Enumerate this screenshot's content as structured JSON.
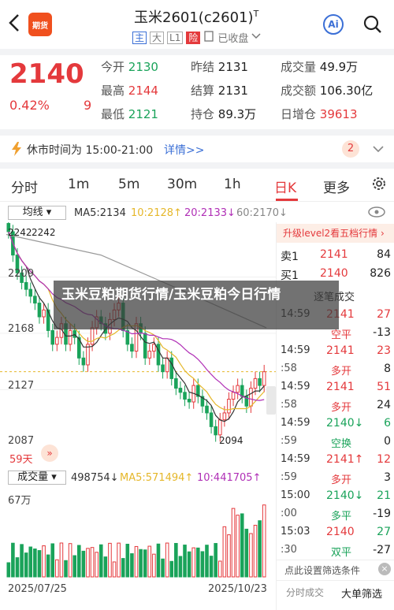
{
  "header": {
    "back_icon": "chevron-left-icon",
    "logo_text": "期货",
    "title": "玉米2601(c2601)",
    "title_sup": "T",
    "tag_main": "主",
    "tag_big": "大",
    "tag_l1": "L1",
    "tag_risk": "险",
    "favorite_label": "已收盘",
    "ai_label": "Ai"
  },
  "quote": {
    "price": "2140",
    "change_pct": "0.42%",
    "change": "9",
    "fields": [
      {
        "k": "今开",
        "v": "2130",
        "c": "green"
      },
      {
        "k": "昨结",
        "v": "2131",
        "c": "plain"
      },
      {
        "k": "成交量",
        "v": "49.9万",
        "c": "plain"
      },
      {
        "k": "最高",
        "v": "2144",
        "c": "red"
      },
      {
        "k": "结算",
        "v": "2131",
        "c": "plain"
      },
      {
        "k": "成交额",
        "v": "106.30亿",
        "c": "plain"
      },
      {
        "k": "最低",
        "v": "2121",
        "c": "green"
      },
      {
        "k": "持仓",
        "v": "89.3万",
        "c": "plain"
      },
      {
        "k": "日增仓",
        "v": "39613",
        "c": "red"
      }
    ]
  },
  "notice": {
    "text": "休市时间为 15:00-21:00",
    "link": "详情>>",
    "badge": "2"
  },
  "tabs": [
    "分时",
    "1m",
    "5m",
    "30m",
    "1h",
    "日K",
    "更多"
  ],
  "active_tab": "日K",
  "chart": {
    "ma_selector": "均线",
    "ma5_label": "MA5:2134",
    "ma10_label": "10:2128↑",
    "ma20_label": "20:2133↓",
    "ma60_label": "60:2170↓",
    "y_ticks": [
      "2242",
      "2209",
      "2168",
      "2127",
      "2087"
    ],
    "high_label": "2242",
    "low_label": "2094",
    "period_label": "59天",
    "vol_selector": "成交量",
    "vol_value": "498754↓",
    "vol_ma5": "MA5:571494↑",
    "vol_ma10": "10:441705↑",
    "vol_axis": "67万",
    "date_start": "2025/07/25",
    "date_end": "2025/10/23",
    "colors": {
      "up": "#e4393c",
      "down": "#1aa35a",
      "ma5": "#333333",
      "ma10": "#e5b72a",
      "ma20": "#b02fb6",
      "ma60": "#999999"
    }
  },
  "chart_data": {
    "type": "candlestick",
    "ylim": [
      2087,
      2242
    ],
    "days": 59,
    "close": [
      2242,
      2225,
      2212,
      2205,
      2200,
      2195,
      2190,
      2180,
      2185,
      2170,
      2160,
      2165,
      2175,
      2160,
      2170,
      2165,
      2150,
      2145,
      2160,
      2172,
      2180,
      2175,
      2168,
      2178,
      2185,
      2190,
      2170,
      2160,
      2155,
      2175,
      2168,
      2150,
      2155,
      2160,
      2145,
      2140,
      2150,
      2135,
      2128,
      2125,
      2120,
      2118,
      2130,
      2122,
      2115,
      2110,
      2100,
      2094,
      2105,
      2110,
      2120,
      2125,
      2130,
      2122,
      2115,
      2128,
      2135,
      2130,
      2140
    ]
  },
  "side_panel": {
    "upgrade_text": "升级level2看五档行情",
    "sell_label": "卖1",
    "sell_price": "2141",
    "sell_vol": "84",
    "buy_label": "买1",
    "buy_price": "2140",
    "buy_vol": "826",
    "recent_label": "逐笔成交",
    "ticks": [
      {
        "time": "14:59",
        "price": "2141",
        "arrow": "",
        "vol": "27",
        "pc": "red",
        "vc": "red"
      },
      {
        "time": "",
        "price": "空平",
        "arrow": "",
        "vol": "-13",
        "pc": "red",
        "vc": "plain"
      },
      {
        "time": "14:59",
        "price": "2141",
        "arrow": "",
        "vol": "23",
        "pc": "red",
        "vc": "red"
      },
      {
        "time": ":58",
        "price": "多开",
        "arrow": "",
        "vol": "8",
        "pc": "red",
        "vc": "plain"
      },
      {
        "time": "14:59",
        "price": "2141",
        "arrow": "",
        "vol": "51",
        "pc": "red",
        "vc": "red"
      },
      {
        "time": ":58",
        "price": "多开",
        "arrow": "",
        "vol": "24",
        "pc": "red",
        "vc": "plain"
      },
      {
        "time": "14:59",
        "price": "2140↓",
        "arrow": "",
        "vol": "6",
        "pc": "green",
        "vc": "green"
      },
      {
        "time": ":59",
        "price": "空换",
        "arrow": "",
        "vol": "0",
        "pc": "green",
        "vc": "plain"
      },
      {
        "time": "14:59",
        "price": "2141↑",
        "arrow": "",
        "vol": "12",
        "pc": "red",
        "vc": "red"
      },
      {
        "time": ":59",
        "price": "多开",
        "arrow": "",
        "vol": "3",
        "pc": "red",
        "vc": "plain"
      },
      {
        "time": "15:00",
        "price": "2140↓",
        "arrow": "",
        "vol": "21",
        "pc": "green",
        "vc": "green"
      },
      {
        "time": ":00",
        "price": "多平",
        "arrow": "",
        "vol": "-19",
        "pc": "green",
        "vc": "plain"
      },
      {
        "time": "15:03",
        "price": "2140",
        "arrow": "",
        "vol": "27",
        "pc": "red",
        "vc": "green"
      },
      {
        "time": ":30",
        "price": "双平",
        "arrow": "",
        "vol": "-27",
        "pc": "green",
        "vc": "plain"
      }
    ],
    "filter_text": "点此设置筛选条件",
    "tab_time": "分时成交",
    "tab_big": "大单筛选"
  },
  "overlay_text": "玉米豆粕期货行情/玉米豆粕今日行情"
}
